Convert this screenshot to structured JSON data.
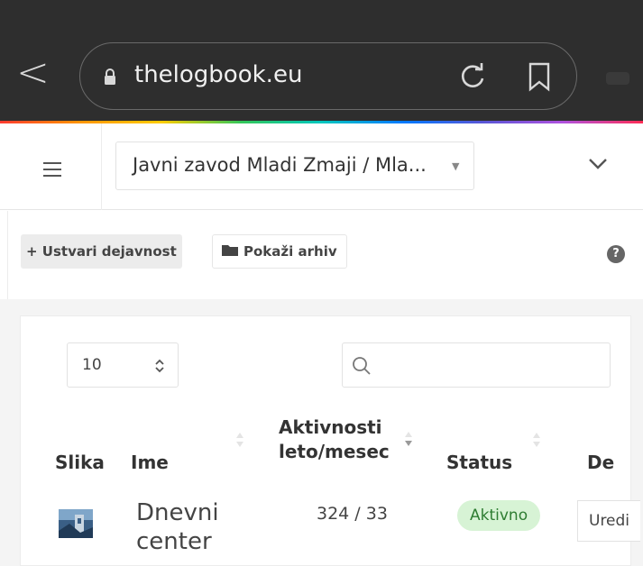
{
  "browser": {
    "url": "thelogbook.eu"
  },
  "header": {
    "organization_select": "Javni zavod Mladi Zmaji / Mla..."
  },
  "toolbar": {
    "create_label": "+ Ustvari dejavnost",
    "archive_label": "Pokaži arhiv",
    "help_label": "?"
  },
  "table": {
    "page_size": "10",
    "columns": {
      "image": "Slika",
      "name": "Ime",
      "activity_line1": "Aktivnosti",
      "activity_line2": "leto/mesec",
      "status": "Status",
      "actions": "De"
    },
    "rows": [
      {
        "name_line1": "Dnevni",
        "name_line2": "center",
        "activity": "324 / 33",
        "status": "Aktivno",
        "action": "Uredi"
      }
    ]
  },
  "colors": {
    "browser_bar": "#2e2e2e",
    "badge_bg": "#d7f3d5",
    "badge_text": "#2e7d32"
  }
}
